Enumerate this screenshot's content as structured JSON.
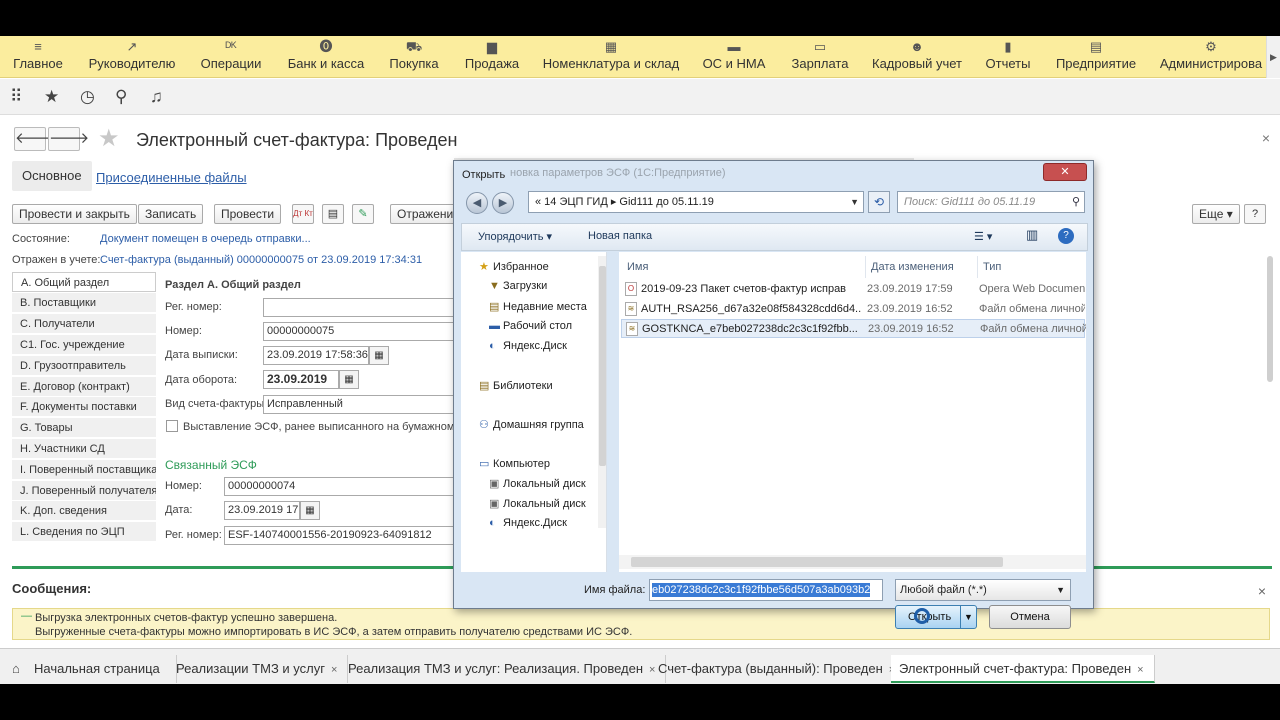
{
  "top_menu": [
    {
      "icon": "menu-icon",
      "glyph": "≡",
      "label": "Главное"
    },
    {
      "icon": "chart-icon",
      "glyph": "↗",
      "label": "Руководителю"
    },
    {
      "icon": "operations-icon",
      "glyph": "ᴰᴷ",
      "label": "Операции"
    },
    {
      "icon": "bank-icon",
      "glyph": "⓿",
      "label": "Банк и касса"
    },
    {
      "icon": "cart-icon",
      "glyph": "⛟",
      "label": "Покупка"
    },
    {
      "icon": "bag-icon",
      "glyph": "▆",
      "label": "Продажа"
    },
    {
      "icon": "warehouse-icon",
      "glyph": "▦",
      "label": "Номенклатура и склад"
    },
    {
      "icon": "truck-icon",
      "glyph": "▬",
      "label": "ОС и НМА"
    },
    {
      "icon": "salary-icon",
      "glyph": "▭",
      "label": "Зарплата"
    },
    {
      "icon": "people-icon",
      "glyph": "☻",
      "label": "Кадровый учет"
    },
    {
      "icon": "reports-icon",
      "glyph": "▮",
      "label": "Отчеты"
    },
    {
      "icon": "enterprise-icon",
      "glyph": "▤",
      "label": "Предприятие"
    },
    {
      "icon": "admin-gear-icon",
      "glyph": "⚙",
      "label": "Администрирова"
    }
  ],
  "toolbar_icons": {
    "apps": "⠿",
    "favorites": "★",
    "history": "◷",
    "search": "⚲",
    "notify": "♫"
  },
  "form": {
    "back": "🡐",
    "forward": "🡒",
    "star": "★",
    "title": "Электронный счет-фактура: Проведен",
    "close": "×",
    "tab_main": "Основное",
    "tab_files": "Присоединенные файлы"
  },
  "buttons": {
    "post_close": "Провести и закрыть",
    "save": "Записать",
    "post": "Провести",
    "dtkt": "Дт Кт",
    "doc": "▤",
    "edit": "✎",
    "reflect": "Отражение",
    "more": "Еще ▾",
    "help": "?"
  },
  "status": {
    "state_label": "Состояние:",
    "state_value": "Документ помещен в очередь отправки...",
    "account_label": "Отражен в учете:",
    "account_value": "Счет-фактура (выданный) 00000000075 от 23.09.2019 17:34:31"
  },
  "sections": [
    "A. Общий раздел",
    "B. Поставщики",
    "C. Получатели",
    "C1. Гос. учреждение",
    "D. Грузоотправитель",
    "E. Договор (контракт)",
    "F. Документы поставки",
    "G. Товары",
    "H. Участники СД",
    "I. Поверенный поставщика",
    "J. Поверенный получателя",
    "K. Доп. сведения",
    "L. Сведения по ЭЦП"
  ],
  "section_a": {
    "heading": "Раздел А. Общий раздел",
    "reg_label": "Рег. номер:",
    "reg_value": "",
    "num_label": "Номер:",
    "num_value": "00000000075",
    "issue_label": "Дата выписки:",
    "issue_value": "23.09.2019 17:58:36",
    "turn_label": "Дата оборота:",
    "turn_value": "23.09.2019",
    "kind_label": "Вид счета-фактуры:",
    "kind_value": "Исправленный",
    "checkbox_label": "Выставление ЭСФ, ранее выписанного на бумажном но",
    "linked_heading": "Связанный ЭСФ",
    "l_num_label": "Номер:",
    "l_num_value": "00000000074",
    "l_date_label": "Дата:",
    "l_date_value": "23.09.2019 17:",
    "l_reg_label": "Рег. номер:",
    "l_reg_value": "ESF-140740001556-20190923-64091812",
    "cal": "▦"
  },
  "messages": {
    "title": "Сообщения:",
    "close": "×",
    "dash": "—",
    "line1": "Выгрузка электронных счетов-фактур успешно завершена.",
    "line2": "Выгруженные счета-фактуры можно импортировать в ИС ЭСФ, а затем отправить получателю средствами ИС ЭСФ."
  },
  "bottom_tabs": [
    {
      "label": "Начальная страница",
      "close": ""
    },
    {
      "label": "Реализации ТМЗ и услуг",
      "close": "×"
    },
    {
      "label": "Реализация ТМЗ и услуг: Реализация. Проведен",
      "close": "×"
    },
    {
      "label": "Счет-фактура (выданный): Проведен",
      "close": "×"
    },
    {
      "label": "Электронный счет-фактура: Проведен",
      "close": "×"
    }
  ],
  "home_icon": "⌂",
  "dialog": {
    "title": "Открыть",
    "bg_title": "новка параметров ЭСФ (1С:Предприятие)",
    "close": "✕",
    "back": "◀",
    "forward": "▶",
    "address": "«  14 ЭЦП ГИД  ▸  Gid111  до 05.11.19",
    "address_dd": "▼",
    "refresh": "⟲",
    "search_placeholder": "Поиск: Gid111 до 05.11.19",
    "search_icon": "⚲",
    "organize": "Упорядочить ▾",
    "new_folder": "Новая папка",
    "view_icon": "☰ ▾",
    "pane_icon": "▥",
    "help": "?",
    "nav": [
      {
        "icon": "★",
        "label": "Избранное"
      },
      {
        "icon": "▼",
        "label": "Загрузки"
      },
      {
        "icon": "▤",
        "label": "Недавние места"
      },
      {
        "icon": "▬",
        "label": "Рабочий стол"
      },
      {
        "icon": "◐",
        "label": "Яндекс.Диск"
      },
      {
        "icon": "▤",
        "label": "Библиотеки"
      },
      {
        "icon": "⚇",
        "label": "Домашняя группа"
      },
      {
        "icon": "▭",
        "label": "Компьютер"
      },
      {
        "icon": "▣",
        "label": "Локальный диск"
      },
      {
        "icon": "▣",
        "label": "Локальный диск"
      },
      {
        "icon": "◐",
        "label": "Яндекс.Диск"
      }
    ],
    "columns": {
      "name": "Имя",
      "date": "Дата изменения",
      "type": "Тип"
    },
    "files": [
      {
        "icon": "O",
        "name": "2019-09-23 Пакет счетов-фактур исправ",
        "date": "23.09.2019 17:59",
        "type": "Opera Web Document"
      },
      {
        "icon": "≋",
        "name": "AUTH_RSA256_d67a32e08f584328cdd6d4...",
        "date": "23.09.2019 16:52",
        "type": "Файл обмена личной информацией"
      },
      {
        "icon": "≋",
        "name": "GOSTKNCA_e7beb027238dc2c3c1f92fbb...",
        "date": "23.09.2019 16:52",
        "type": "Файл обмена личной информацией"
      }
    ],
    "filename_label": "Имя файла:",
    "filename_value": "eb027238dc2c3c1f92fbbe56d507a3ab093b2",
    "filter": "Любой файл (*.*)",
    "open": "Открыть",
    "cancel": "Отмена",
    "dd": "▼"
  }
}
